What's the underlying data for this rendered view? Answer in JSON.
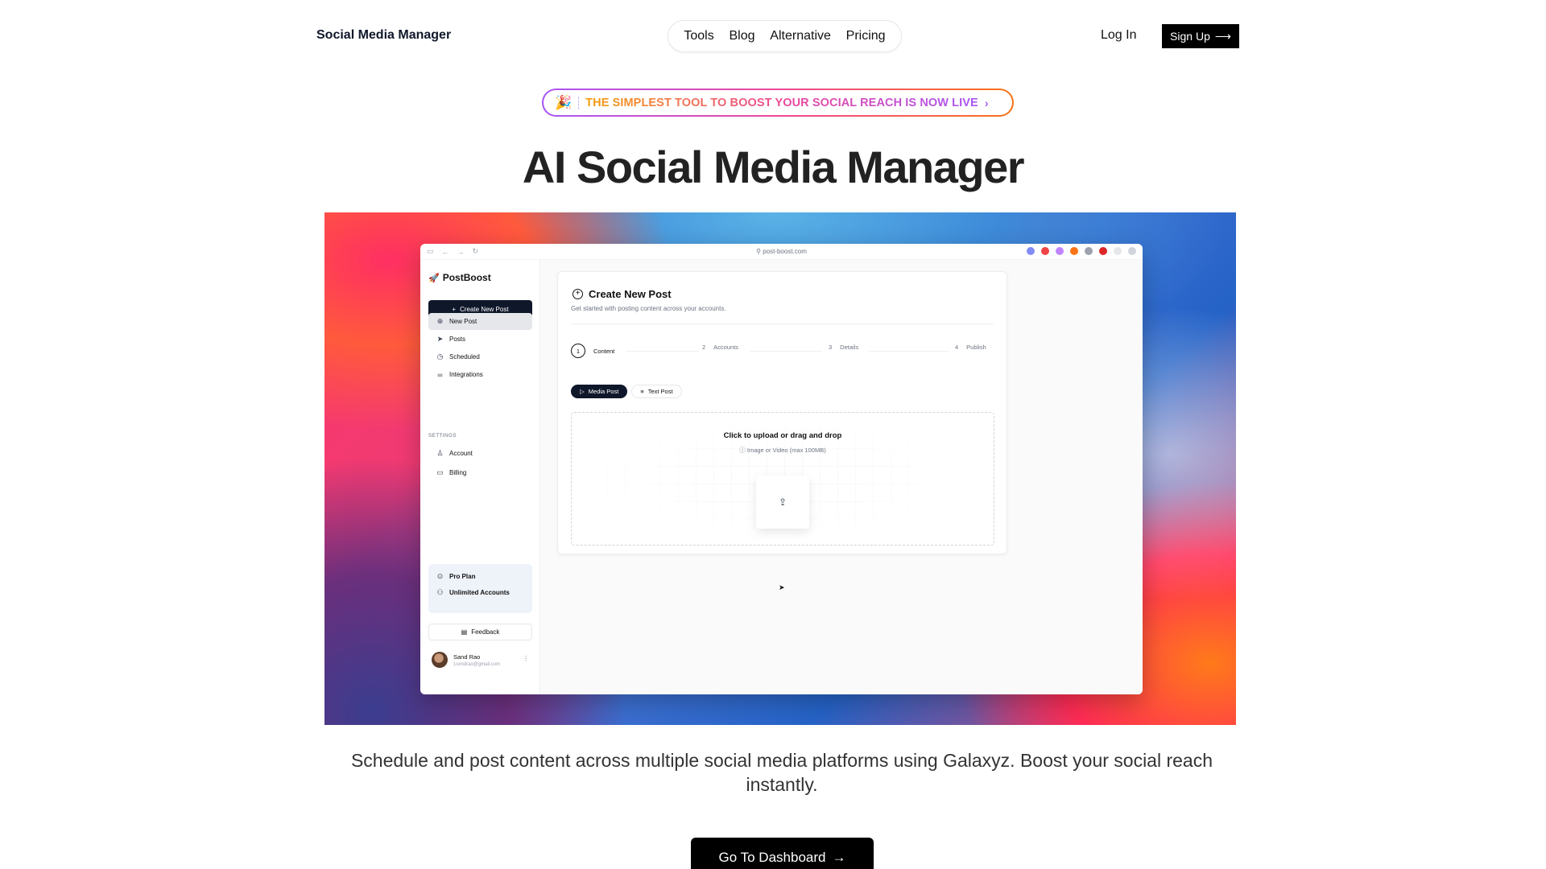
{
  "nav": {
    "brand": "Social Media Manager",
    "links": [
      "Tools",
      "Blog",
      "Alternative",
      "Pricing"
    ],
    "login": "Log In",
    "signup": "Sign Up"
  },
  "announcement": {
    "emoji": "🎉",
    "text": "THE SIMPLEST TOOL TO BOOST YOUR SOCIAL REACH IS NOW LIVE",
    "chevron": "›"
  },
  "hero": {
    "title": "AI Social Media Manager",
    "description": "Schedule and post content across multiple social media platforms using Galaxyz. Boost your social reach instantly.",
    "cta": "Go To Dashboard"
  },
  "app": {
    "url": "post-boost.com",
    "logo": "PostBoost",
    "create_button": "Create New Post",
    "sidebar_items": [
      "New Post",
      "Posts",
      "Scheduled",
      "Integrations"
    ],
    "settings_heading": "SETTINGS",
    "settings_items": [
      "Account",
      "Billing"
    ],
    "plan_items": [
      "Pro Plan",
      "Unlimited Accounts"
    ],
    "feedback": "Feedback",
    "user": {
      "name": "Sand Rao",
      "email": "1sxndrao@gmail.com"
    },
    "card": {
      "title": "Create New Post",
      "subtitle": "Get started with posting content across your accounts.",
      "steps": [
        {
          "num": "1",
          "label": "Content"
        },
        {
          "num": "2",
          "label": "Accounts"
        },
        {
          "num": "3",
          "label": "Details"
        },
        {
          "num": "4",
          "label": "Publish"
        }
      ],
      "tabs": [
        "Media Post",
        "Text Post"
      ],
      "dropzone_title": "Click to upload or drag and drop",
      "dropzone_sub": "Image or Video (max 100MB)"
    }
  },
  "colors": {
    "accent_dark": "#0f172a",
    "announce_gradient": [
      "#a855f7",
      "#ec4899",
      "#f97316"
    ]
  }
}
